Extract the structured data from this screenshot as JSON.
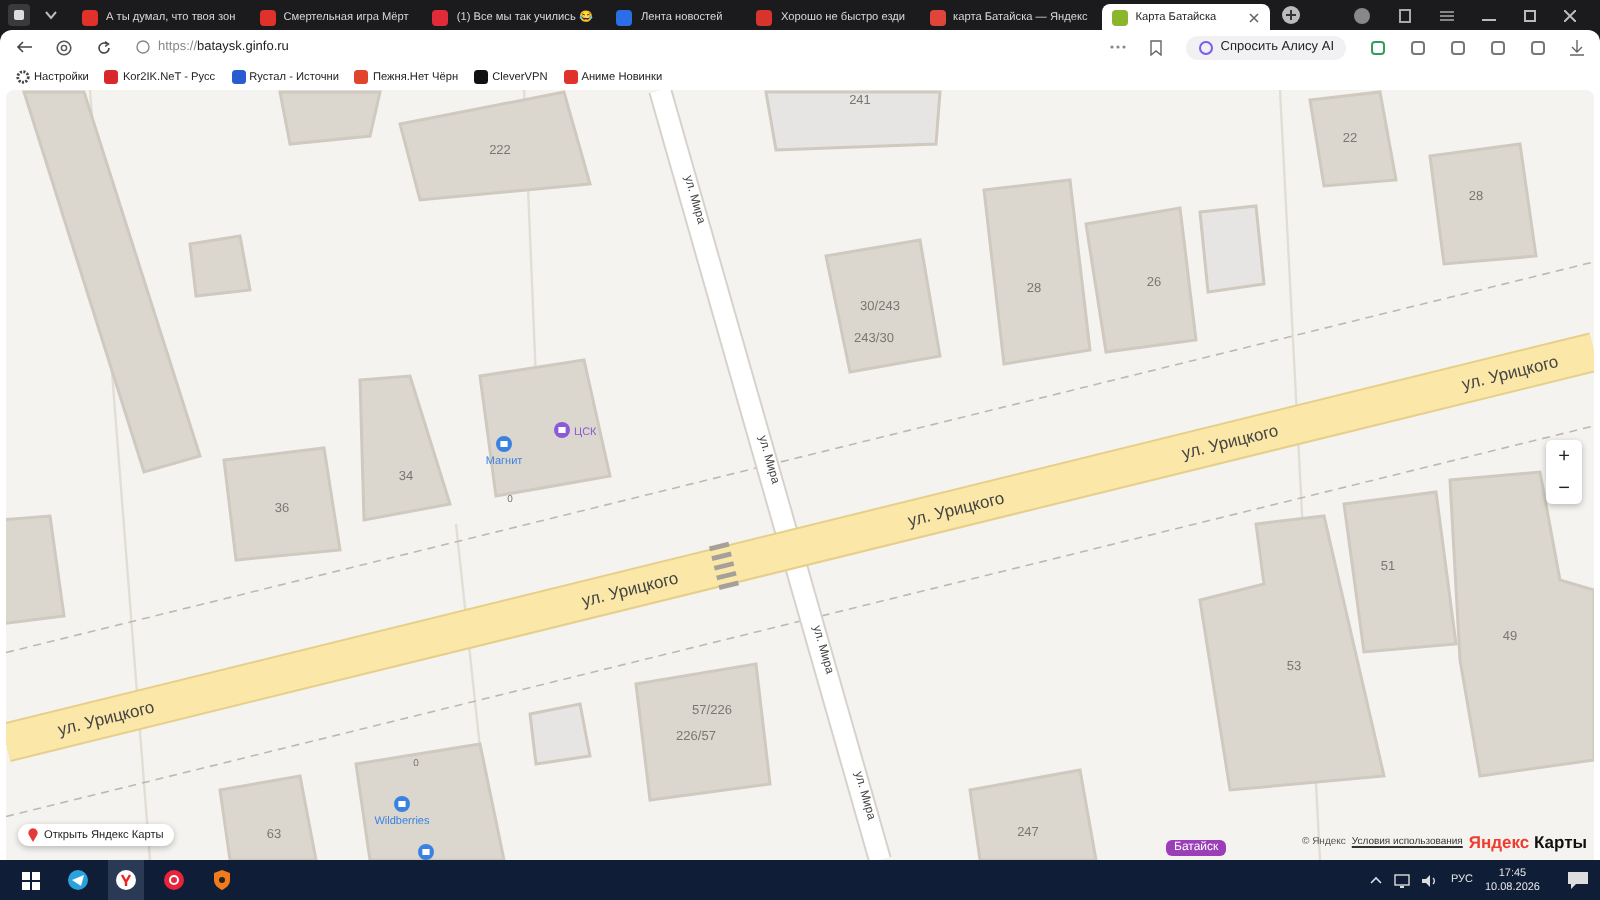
{
  "browser": {
    "tabs": [
      {
        "title": "А ты думал, что твоя зон",
        "selected": false
      },
      {
        "title": "Смертельная игра Мёрт",
        "selected": false
      },
      {
        "title": "(1) Все мы так учились 😂",
        "selected": false
      },
      {
        "title": "Лента новостей",
        "selected": false
      },
      {
        "title": "Хорошо не быстро езди",
        "selected": false
      },
      {
        "title": "карта Батайска — Яндекс",
        "selected": false
      },
      {
        "title": "Карта Батайска",
        "selected": true
      }
    ],
    "address": {
      "scheme": "https://",
      "host": "bataysk.ginfo.ru"
    },
    "alice_button": "Спросить Алису AI",
    "bookmarks": [
      "Настройки",
      "Kor2IK.NeT - Русс",
      "Rустал - Источни",
      "Пежня.Нет Чёрн",
      "CleverVPN",
      "Аниме Новинки"
    ]
  },
  "map": {
    "street_labels": [
      "ул. Урицкого",
      "ул. Урицкого",
      "ул. Урицкого",
      "ул. Урицкого",
      "ул. Урицкого",
      "ул. Мира",
      "ул. Мира",
      "ул. Мира",
      "ул. Мира"
    ],
    "building_numbers": [
      "241",
      "222",
      "22",
      "28",
      "28",
      "26",
      "30/243",
      "243/30",
      "34",
      "36",
      "51",
      "53",
      "49",
      "57/226",
      "226/57",
      "63",
      "247",
      "0",
      "0"
    ],
    "pois": [
      {
        "label": "Магнит",
        "color": "#3a82e0"
      },
      {
        "label": "ЦСК",
        "color": "#8c5ad6"
      },
      {
        "label": "Wildberries",
        "color": "#3a82e0"
      }
    ],
    "open_button": "Открыть Яндекс Карты",
    "city_badge": "Батайск",
    "copyright": "© Яндекс",
    "terms_link": "Условия использования",
    "logo": {
      "brand": "Яндекс",
      "product": "Карты"
    },
    "zoom": {
      "in": "+",
      "out": "−"
    }
  },
  "taskbar": {
    "language": "РУС",
    "time": "17:45",
    "date": "10.08.2026"
  }
}
